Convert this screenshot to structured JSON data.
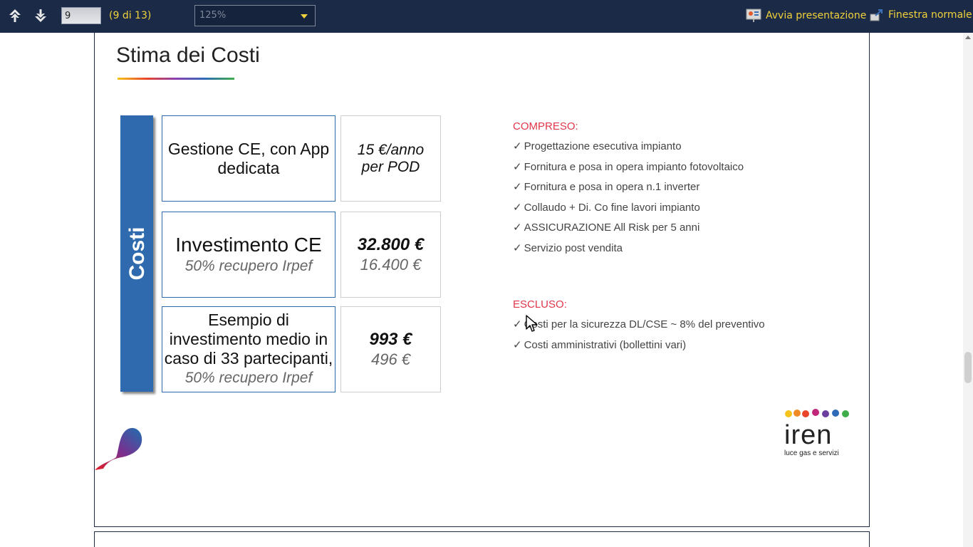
{
  "toolbar": {
    "prev_label": "",
    "next_label": "",
    "page_input": "9",
    "page_count": "(9 di 13)",
    "zoom": "125%",
    "present_label": "Avvia presentazione",
    "normal_label": "Finestra normale"
  },
  "slide": {
    "title": "Stima dei Costi",
    "side_label": "Costi",
    "rows": [
      {
        "label_lines": [
          "Gestione CE, con App",
          "dedicata"
        ],
        "value_lines": [
          "15 €/anno",
          "per POD"
        ]
      },
      {
        "label_main": "Investimento CE",
        "label_sub": "50% recupero Irpef",
        "value_main": "32.800 €",
        "value_sub": "16.400  €"
      },
      {
        "label_lines": [
          "Esempio di",
          "investimento medio in",
          "caso di 33 partecipanti,"
        ],
        "label_sub": "50% recupero Irpef",
        "value_main": "993 €",
        "value_sub": "496 €"
      }
    ],
    "included_title": "COMPRESO:",
    "included": [
      "Progettazione esecutiva impianto",
      "Fornitura e posa in opera impianto fotovoltaico",
      "Fornitura e posa in opera n.1 inverter",
      "Collaudo + Di. Co fine lavori impianto",
      "ASSICURAZIONE All Risk per 5 anni",
      "Servizio post vendita"
    ],
    "excluded_title": "ESCLUSO:",
    "excluded": [
      "Costi per la sicurezza DL/CSE ~ 8% del preventivo",
      "Costi amministrativi (bollettini vari)"
    ],
    "check": "✓",
    "logo_text": "iren",
    "logo_tagline": "luce gas e servizi"
  },
  "colors": {
    "toolbar_bg": "#1b2a47",
    "toolbar_text": "#f2d23a",
    "accent_blue": "#2e6aad",
    "list_head": "#e0364a"
  }
}
